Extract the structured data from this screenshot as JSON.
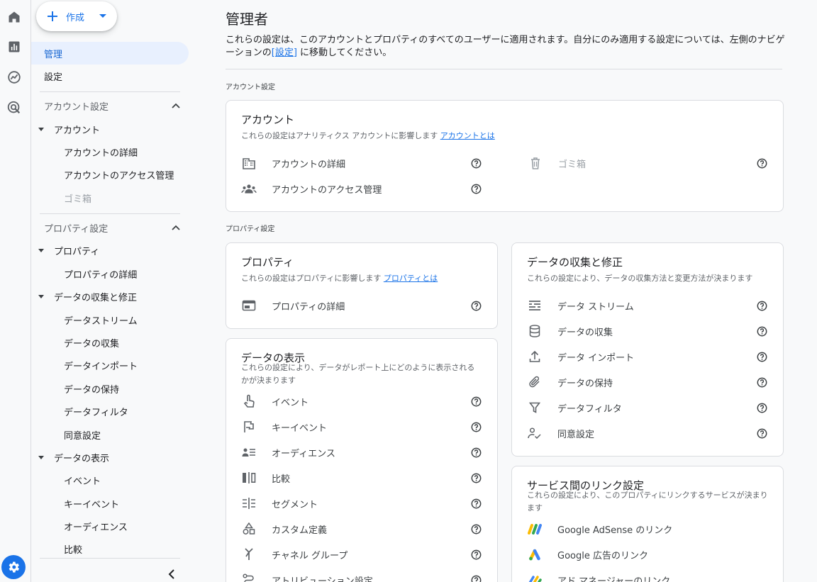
{
  "create": {
    "label": "作成"
  },
  "nav": {
    "admin": "管理",
    "settings": "設定",
    "account_section": "アカウント設定",
    "account_group": "アカウント",
    "account_items": [
      "アカウントの詳細",
      "アカウントのアクセス管理",
      "ゴミ箱"
    ],
    "property_section": "プロパティ設定",
    "property_group": "プロパティ",
    "property_items": [
      "プロパティの詳細"
    ],
    "collection_group": "データの収集と修正",
    "collection_items": [
      "データストリーム",
      "データの収集",
      "データインポート",
      "データの保持",
      "データフィルタ",
      "同意設定"
    ],
    "display_group": "データの表示",
    "display_items": [
      "イベント",
      "キーイベント",
      "オーディエンス",
      "比較"
    ]
  },
  "main": {
    "title": "管理者",
    "intro_before": "これらの設定は、このアカウントとプロパティのすべてのユーザーに適用されます。自分にのみ適用する設定については、左側のナビゲーションの",
    "intro_link": "[設定]",
    "intro_after": " に移動してください。",
    "account_label": "アカウント設定",
    "property_label": "プロパティ設定"
  },
  "cards": {
    "account": {
      "title": "アカウント",
      "desc": "これらの設定はアナリティクス アカウントに影響します ",
      "link": "アカウントとは",
      "rows": [
        "アカウントの詳細",
        "アカウントのアクセス管理"
      ],
      "trash": "ゴミ箱"
    },
    "property": {
      "title": "プロパティ",
      "desc": "これらの設定はプロパティに影響します ",
      "link": "プロパティとは",
      "rows": [
        "プロパティの詳細"
      ]
    },
    "display": {
      "title": "データの表示",
      "desc": "これらの設定により、データがレポート上にどのように表示されるかが決まります",
      "rows": [
        "イベント",
        "キーイベント",
        "オーディエンス",
        "比較",
        "セグメント",
        "カスタム定義",
        "チャネル グループ",
        "アトリビューション設定"
      ]
    },
    "collection": {
      "title": "データの収集と修正",
      "desc": "これらの設定により、データの収集方法と変更方法が決まります",
      "rows": [
        "データ ストリーム",
        "データの収集",
        "データ インポート",
        "データの保持",
        "データフィルタ",
        "同意設定"
      ]
    },
    "links": {
      "title": "サービス間のリンク設定",
      "desc": "これらの設定により、このプロパティにリンクするサービスが決まります",
      "rows": [
        "Google AdSense のリンク",
        "Google 広告のリンク",
        "アド マネージャーのリンク"
      ]
    }
  }
}
